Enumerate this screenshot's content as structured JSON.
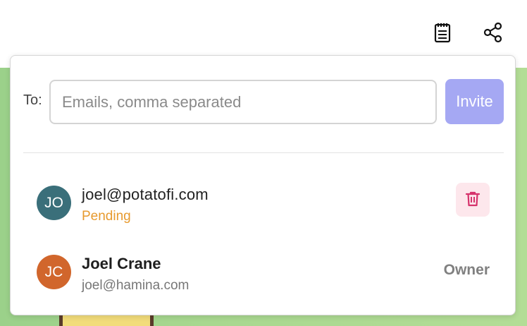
{
  "header": {
    "notes_icon": "clipboard-icon",
    "share_icon": "share-icon"
  },
  "invite": {
    "to_label": "To:",
    "email_placeholder": "Emails, comma separated",
    "email_value": "",
    "invite_label": "Invite",
    "invite_color": "#a5a8f3"
  },
  "members": [
    {
      "initials": "JO",
      "avatar_color": "#3a6f7a",
      "title": "joel@potatofi.com",
      "subtitle": "Pending",
      "subtitle_color": "#e79a2e",
      "action_icon": "trash-icon"
    },
    {
      "initials": "JC",
      "avatar_color": "#d1662c",
      "title": "Joel Crane",
      "subtitle": "joel@hamina.com",
      "role": "Owner"
    }
  ]
}
